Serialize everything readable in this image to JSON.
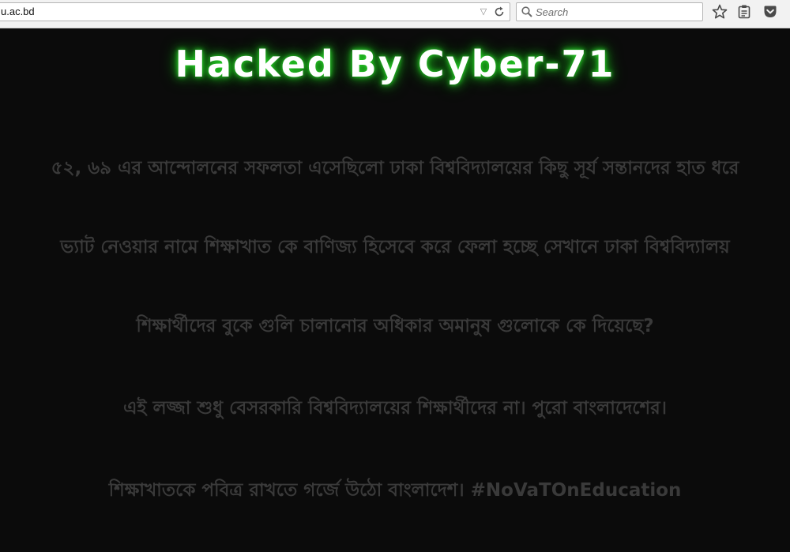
{
  "browser": {
    "url": "u.ac.bd",
    "search_placeholder": "Search",
    "icons": {
      "dropdown": "chevron-down-icon",
      "reload": "reload-icon",
      "search": "search-icon",
      "bookmark": "star-icon",
      "reading_list": "reading-list-icon",
      "pocket": "pocket-icon"
    }
  },
  "page": {
    "headline": "Hacked By Cyber-71",
    "lines": [
      "৫২, ৬৯ এর আন্দোলনের সফলতা এসেছিলো ঢাকা বিশ্ববিদ্যালয়ের কিছু সূর্য সন্তানদের হাত ধরে",
      "ভ্যাট নেওয়ার নামে শিক্ষাখাত কে বাণিজ্য হিসেবে করে ফেলা হচ্ছে সেখানে ঢাকা বিশ্ববিদ্যালয়",
      "শিক্ষার্থীদের বুকে গুলি চালানোর অধিকার অমানুষ গুলোকে কে দিয়েছে?",
      "এই লজ্জা শুধু বেসরকারি বিশ্ববিদ্যালয়ের শিক্ষার্থীদের না। পুরো বাংলাদেশের।",
      "শিক্ষাখাতকে পবিত্র রাখতে গর্জে উঠো বাংলাদেশ। #NoVaTOnEducation"
    ],
    "colors": {
      "background": "#0b0b0b",
      "headline": "#ffffff",
      "headline_glow": "#2bd62b",
      "body_text": "#3a3a3a"
    }
  }
}
